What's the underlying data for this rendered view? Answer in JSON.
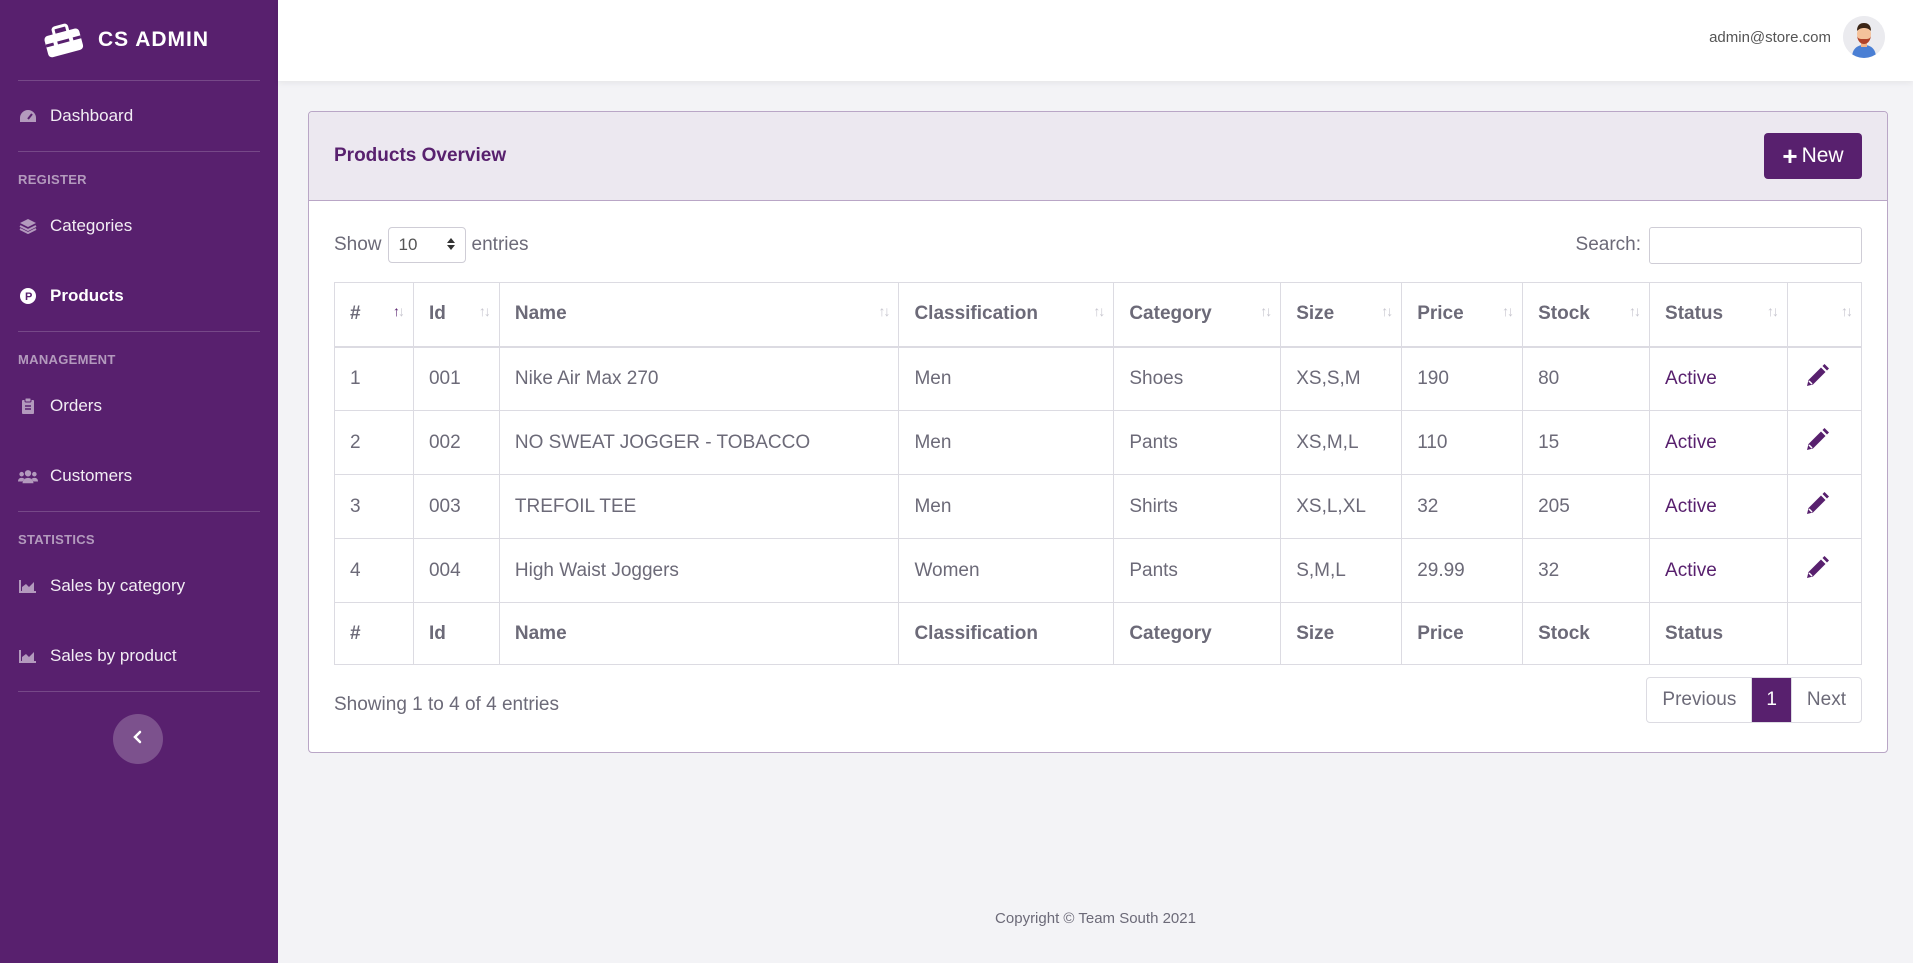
{
  "brand": {
    "name": "CS ADMIN",
    "icon": "toolbox-icon"
  },
  "sidebar": {
    "dashboard": "Dashboard",
    "section_register": "REGISTER",
    "categories": "Categories",
    "products": "Products",
    "section_management": "MANAGEMENT",
    "orders": "Orders",
    "customers": "Customers",
    "section_statistics": "STATISTICS",
    "sales_by_category": "Sales by category",
    "sales_by_product": "Sales by product"
  },
  "user": {
    "email": "admin@store.com"
  },
  "card": {
    "title": "Products Overview",
    "new_label": "New"
  },
  "controls": {
    "show": "Show",
    "entries_value": "10",
    "entries": "entries",
    "search": "Search:"
  },
  "table": {
    "headers": [
      "#",
      "Id",
      "Name",
      "Classification",
      "Category",
      "Size",
      "Price",
      "Stock",
      "Status"
    ],
    "rows": [
      [
        "1",
        "001",
        "Nike Air Max 270",
        "Men",
        "Shoes",
        "XS,S,M",
        "190",
        "80",
        "Active"
      ],
      [
        "2",
        "002",
        "NO SWEAT JOGGER - TOBACCO",
        "Men",
        "Pants",
        "XS,M,L",
        "110",
        "15",
        "Active"
      ],
      [
        "3",
        "003",
        "TREFOIL TEE",
        "Men",
        "Shirts",
        "XS,L,XL",
        "32",
        "205",
        "Active"
      ],
      [
        "4",
        "004",
        "High Waist Joggers",
        "Women",
        "Pants",
        "S,M,L",
        "29.99",
        "32",
        "Active"
      ]
    ]
  },
  "info": "Showing 1 to 4 of 4 entries",
  "pager": {
    "previous": "Previous",
    "current": "1",
    "next": "Next"
  },
  "footer": "Copyright © Team South 2021",
  "colors": {
    "primary": "#58206e",
    "header_bg": "#ece8f0"
  }
}
